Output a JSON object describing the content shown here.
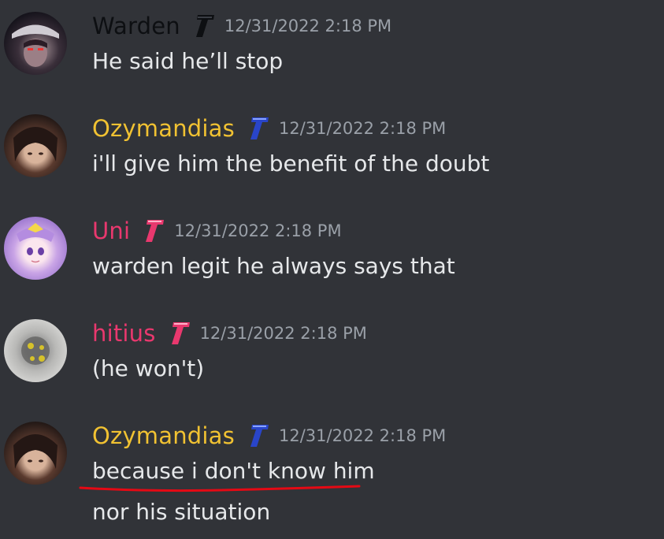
{
  "colors": {
    "background": "#313338",
    "warden": "#0d0f12",
    "ozymandias": "#f1c232",
    "uni": "#e9386e",
    "hitius": "#e9386e",
    "timestamp": "#9aa0a8",
    "message_text": "#e6e8ea",
    "underline": "#e50914"
  },
  "messages": [
    {
      "username": "Warden",
      "badge_icon": "t-black",
      "timestamp": "12/31/2022 2:18 PM",
      "lines": [
        "He said he’ll stop"
      ]
    },
    {
      "username": "Ozymandias",
      "badge_icon": "t-blue",
      "timestamp": "12/31/2022 2:18 PM",
      "lines": [
        "i'll give him the benefit of the doubt"
      ]
    },
    {
      "username": "Uni",
      "badge_icon": "t-pink",
      "timestamp": "12/31/2022 2:18 PM",
      "lines": [
        "warden legit he always says that"
      ]
    },
    {
      "username": "hitius",
      "badge_icon": "t-pink",
      "timestamp": "12/31/2022 2:18 PM",
      "lines": [
        "(he won't)"
      ]
    },
    {
      "username": "Ozymandias",
      "badge_icon": "t-blue",
      "timestamp": "12/31/2022 2:18 PM",
      "lines": [
        "because i don't know him",
        "nor his situation"
      ]
    }
  ]
}
